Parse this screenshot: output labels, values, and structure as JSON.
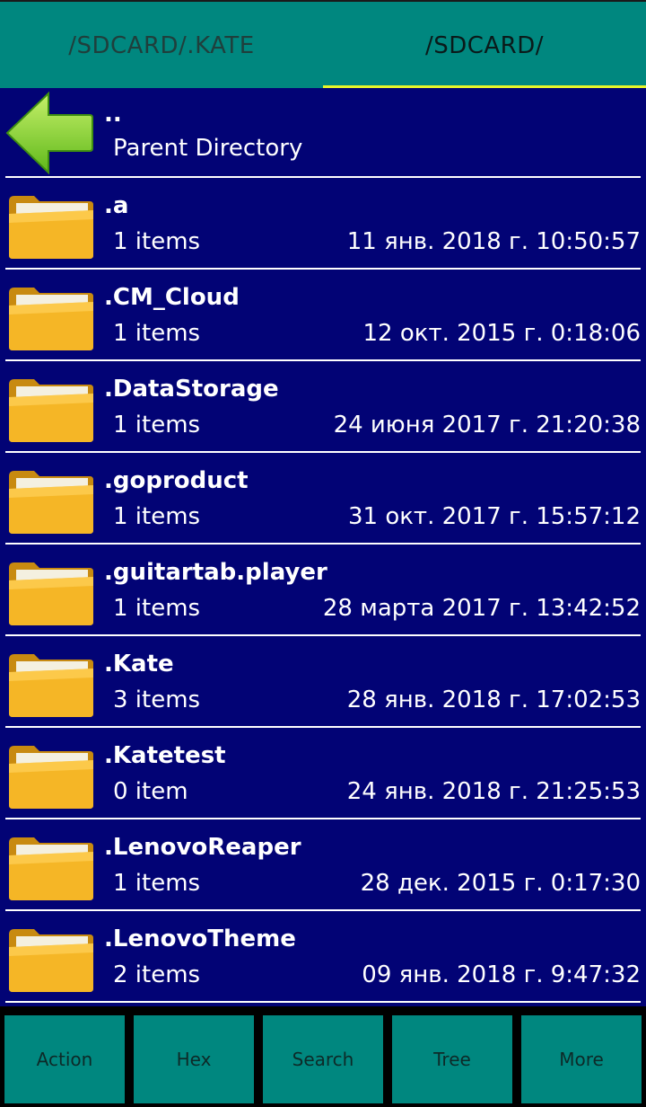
{
  "tabs": [
    {
      "label": "/SDCARD/.KATE",
      "active": false
    },
    {
      "label": "/SDCARD/",
      "active": true
    }
  ],
  "colors": {
    "tabbar": "#00877f",
    "indicator": "#e6f52a",
    "list_bg": "#020375",
    "text": "#ffffff",
    "button_bg": "#00877f"
  },
  "parent": {
    "name": "..",
    "label": "Parent Directory",
    "icon": "back-arrow-icon"
  },
  "entries": [
    {
      "name": ".a",
      "count": "1 items",
      "date": "11 янв. 2018 г. 10:50:57"
    },
    {
      "name": ".CM_Cloud",
      "count": "1 items",
      "date": "12 окт. 2015 г. 0:18:06"
    },
    {
      "name": ".DataStorage",
      "count": "1 items",
      "date": "24 июня 2017 г. 21:20:38"
    },
    {
      "name": ".goproduct",
      "count": "1 items",
      "date": "31 окт. 2017 г. 15:57:12"
    },
    {
      "name": ".guitartab.player",
      "count": "1 items",
      "date": "28 марта 2017 г. 13:42:52"
    },
    {
      "name": ".Kate",
      "count": "3 items",
      "date": "28 янв. 2018 г. 17:02:53"
    },
    {
      "name": ".Katetest",
      "count": "0 item",
      "date": "24 янв. 2018 г. 21:25:53"
    },
    {
      "name": ".LenovoReaper",
      "count": "1 items",
      "date": "28 дек. 2015 г. 0:17:30"
    },
    {
      "name": ".LenovoTheme",
      "count": "2 items",
      "date": "09 янв. 2018 г. 9:47:32"
    }
  ],
  "toolbar": {
    "action": "Action",
    "hex": "Hex",
    "search": "Search",
    "tree": "Tree",
    "more": "More"
  }
}
